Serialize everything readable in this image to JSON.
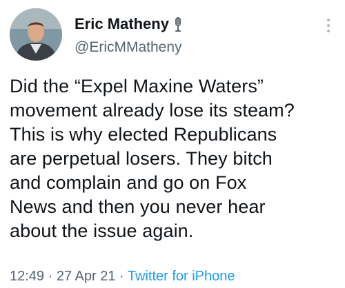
{
  "author": {
    "display_name": "Eric Matheny",
    "handle": "@EricMMatheny",
    "name_badge_icon": "microphone-icon"
  },
  "more_icon": "more-vertical-icon",
  "tweet": {
    "text": "Did the “Expel Maxine Waters”\nmovement already lose its steam?\nThis is why elected Republicans\nare perpetual losers. They bitch\nand complain and go on Fox\nNews and then you never hear\nabout the issue again."
  },
  "meta": {
    "time": "12:49",
    "separator": " · ",
    "date": "27 Apr 21",
    "source": "Twitter for iPhone"
  },
  "colors": {
    "text": "#0f1419",
    "secondary": "#536471",
    "link": "#1d9bf0"
  }
}
